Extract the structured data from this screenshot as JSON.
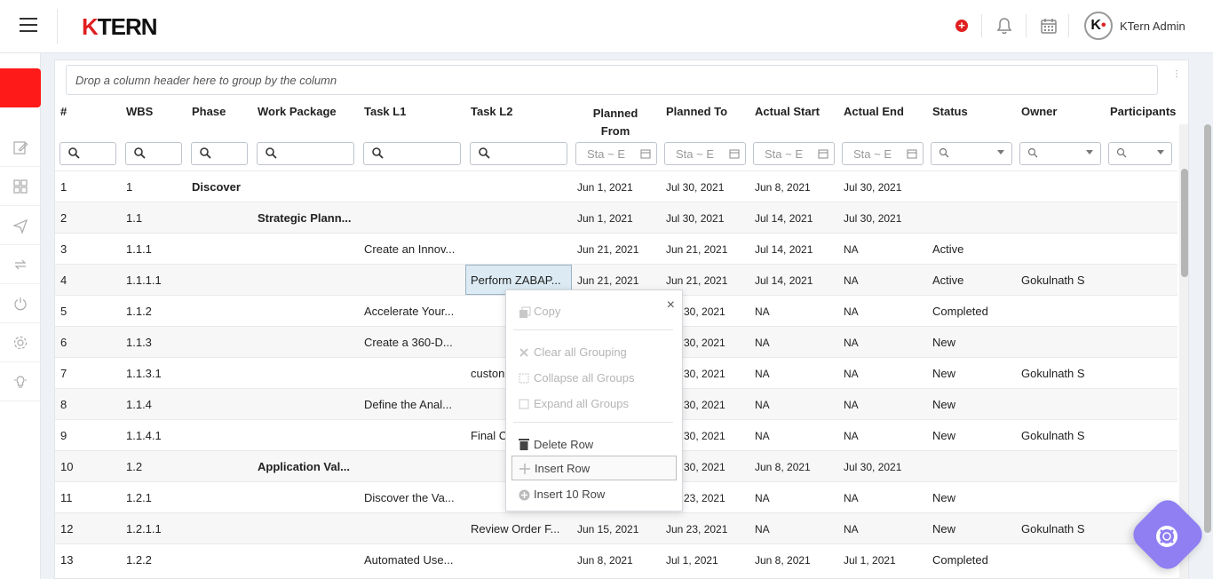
{
  "header": {
    "logo": "KTERN",
    "username": "KTern Admin",
    "avatar_letter": "K"
  },
  "group_area": {
    "placeholder": "Drop a column header here to group by the column"
  },
  "columns": [
    "#",
    "WBS",
    "Phase",
    "Work Package",
    "Task L1",
    "Task L2",
    "Planned From",
    "Planned To",
    "Actual Start",
    "Actual End",
    "Status",
    "Owner",
    "Participants"
  ],
  "date_filter": {
    "start": "Sta",
    "sep": "~",
    "end": "E"
  },
  "rows": [
    {
      "n": "1",
      "wbs": "1",
      "phase": "Discover",
      "wp": "",
      "l1": "",
      "l2": "",
      "pf": "Jun 1, 2021",
      "pt": "Jul 30, 2021",
      "as": "Jun 8, 2021",
      "ae": "Jul 30, 2021",
      "status": "",
      "owner": ""
    },
    {
      "n": "2",
      "wbs": "1.1",
      "phase": "",
      "wp": "Strategic Plann...",
      "l1": "",
      "l2": "",
      "pf": "Jun 1, 2021",
      "pt": "Jul 30, 2021",
      "as": "Jul 14, 2021",
      "ae": "Jul 30, 2021",
      "status": "",
      "owner": ""
    },
    {
      "n": "3",
      "wbs": "1.1.1",
      "phase": "",
      "wp": "",
      "l1": "Create an Innov...",
      "l2": "",
      "pf": "Jun 21, 2021",
      "pt": "Jun 21, 2021",
      "as": "Jul 14, 2021",
      "ae": "NA",
      "status": "Active",
      "owner": ""
    },
    {
      "n": "4",
      "wbs": "1.1.1.1",
      "phase": "",
      "wp": "",
      "l1": "",
      "l2": "Perform ZABAP...",
      "pf": "Jun 21, 2021",
      "pt": "Jun 21, 2021",
      "as": "Jul 14, 2021",
      "ae": "NA",
      "status": "Active",
      "owner": "Gokulnath S"
    },
    {
      "n": "5",
      "wbs": "1.1.2",
      "phase": "",
      "wp": "",
      "l1": "Accelerate Your...",
      "l2": "",
      "pf": "",
      "pt": "30, 2021",
      "as": "NA",
      "ae": "NA",
      "status": "Completed",
      "owner": ""
    },
    {
      "n": "6",
      "wbs": "1.1.3",
      "phase": "",
      "wp": "",
      "l1": "Create a 360-D...",
      "l2": "",
      "pf": "",
      "pt": "30, 2021",
      "as": "NA",
      "ae": "NA",
      "status": "New",
      "owner": ""
    },
    {
      "n": "7",
      "wbs": "1.1.3.1",
      "phase": "",
      "wp": "",
      "l1": "",
      "l2": "custon",
      "pf": "",
      "pt": "30, 2021",
      "as": "NA",
      "ae": "NA",
      "status": "New",
      "owner": "Gokulnath S"
    },
    {
      "n": "8",
      "wbs": "1.1.4",
      "phase": "",
      "wp": "",
      "l1": "Define the Anal...",
      "l2": "",
      "pf": "",
      "pt": "30, 2021",
      "as": "NA",
      "ae": "NA",
      "status": "New",
      "owner": ""
    },
    {
      "n": "9",
      "wbs": "1.1.4.1",
      "phase": "",
      "wp": "",
      "l1": "",
      "l2": "Final C",
      "pf": "",
      "pt": "30, 2021",
      "as": "NA",
      "ae": "NA",
      "status": "New",
      "owner": "Gokulnath S"
    },
    {
      "n": "10",
      "wbs": "1.2",
      "phase": "",
      "wp": "Application Val...",
      "l1": "",
      "l2": "",
      "pf": "",
      "pt": "30, 2021",
      "as": "Jun 8, 2021",
      "ae": "Jul 30, 2021",
      "status": "",
      "owner": ""
    },
    {
      "n": "11",
      "wbs": "1.2.1",
      "phase": "",
      "wp": "",
      "l1": "Discover the Va...",
      "l2": "",
      "pf": "",
      "pt": "23, 2021",
      "as": "NA",
      "ae": "NA",
      "status": "New",
      "owner": ""
    },
    {
      "n": "12",
      "wbs": "1.2.1.1",
      "phase": "",
      "wp": "",
      "l1": "",
      "l2": "Review Order F...",
      "pf": "Jun 15, 2021",
      "pt": "Jun 23, 2021",
      "as": "NA",
      "ae": "NA",
      "status": "New",
      "owner": "Gokulnath S"
    },
    {
      "n": "13",
      "wbs": "1.2.2",
      "phase": "",
      "wp": "",
      "l1": "Automated Use...",
      "l2": "",
      "pf": "Jun 8, 2021",
      "pt": "Jul 1, 2021",
      "as": "Jun 8, 2021",
      "ae": "Jul 1, 2021",
      "status": "Completed",
      "owner": ""
    }
  ],
  "context_menu": {
    "copy": "Copy",
    "clear_grouping": "Clear all Grouping",
    "collapse_groups": "Collapse all Groups",
    "expand_groups": "Expand all Groups",
    "delete_row": "Delete Row",
    "insert_row": "Insert Row",
    "insert_10_row": "Insert 10 Row",
    "close": "×"
  },
  "colors": {
    "accent_red": "#e02020",
    "fab": "#8f7ff3",
    "selected_cell": "#dbeaf3"
  }
}
